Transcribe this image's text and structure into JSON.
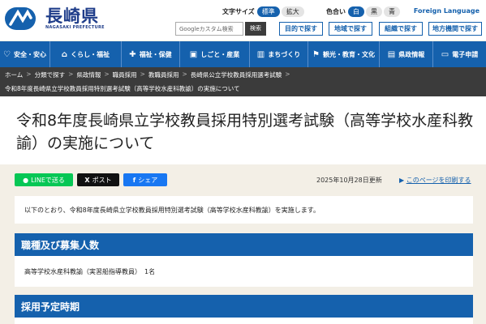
{
  "header": {
    "logo_jp": "長崎県",
    "logo_en": "NAGASAKI PREFECTURE",
    "font_size_label": "文字サイズ",
    "font_size_standard": "標準",
    "font_size_large": "拡大",
    "color_label": "色合い",
    "color_white": "白",
    "color_black": "黒",
    "color_blue": "青",
    "foreign_language": "Foreign Language",
    "search_placeholder": "Googleカスタム検索",
    "search_button": "検索",
    "find_by_purpose": "目的で探す",
    "find_by_region": "地域で探す",
    "find_by_org": "組織で探す",
    "find_by_local_office": "地方機関で探す"
  },
  "nav": {
    "items": [
      {
        "label": "安全・安心",
        "icon": "shield-heart-icon"
      },
      {
        "label": "くらし・福祉",
        "icon": "home-icon"
      },
      {
        "label": "福祉・保健",
        "icon": "stethoscope-icon"
      },
      {
        "label": "しごと・産業",
        "icon": "briefcase-icon"
      },
      {
        "label": "まちづくり",
        "icon": "city-icon"
      },
      {
        "label": "観光・教育・文化",
        "icon": "flag-icon"
      },
      {
        "label": "県政情報",
        "icon": "document-icon"
      },
      {
        "label": "電子申請",
        "icon": "laptop-icon"
      }
    ]
  },
  "breadcrumb": {
    "items": [
      "ホーム",
      "分類で探す",
      "県政情報",
      "職員採用",
      "教職員採用",
      "長崎県公立学校教員採用選考試験"
    ],
    "current": "令和8年度長崎県立学校教員採用特別選考試験（高等学校水産科教諭）の実施について"
  },
  "page": {
    "title": "令和8年度長崎県立学校教員採用特別選考試験（高等学校水産科教諭）の実施について",
    "share_line": "LINEで送る",
    "share_x": "ポスト",
    "share_facebook": "シェア",
    "updated": "2025年10月28日更新",
    "print": "このページを印刷する",
    "intro": "以下のとおり、令和8年度長崎県立学校教員採用特別選考試験（高等学校水産科教諭）を実施します。"
  },
  "sections": [
    {
      "heading": "職種及び募集人数",
      "body": "高等学校水産科教諭（実習船指導教員）　1名"
    },
    {
      "heading": "採用予定時期",
      "body": ""
    }
  ],
  "colors": {
    "brand_blue": "#1561ad",
    "background": "#f3efe6",
    "breadcrumb_bg": "#3b3b3b",
    "line_green": "#06c755",
    "facebook_blue": "#1877f2"
  }
}
